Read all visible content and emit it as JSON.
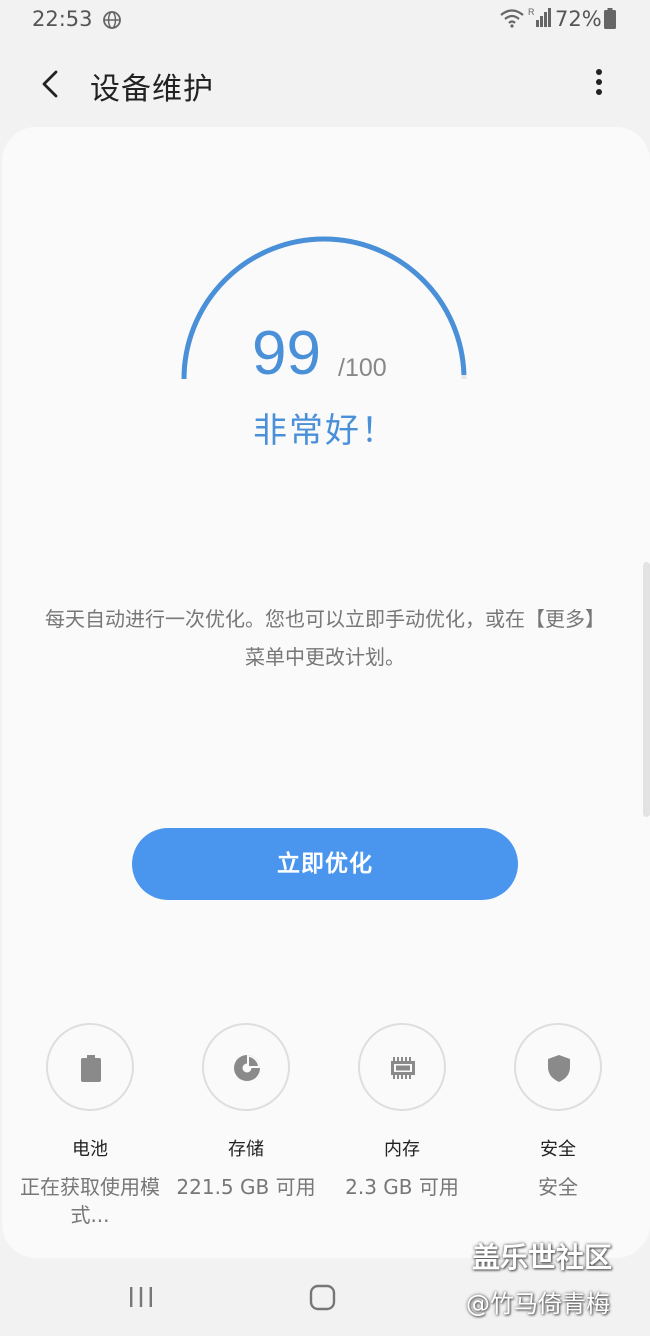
{
  "status_bar": {
    "time": "22:53",
    "battery_percent": "72%"
  },
  "header": {
    "title": "设备维护"
  },
  "score": {
    "value": "99",
    "max": "/100",
    "status": "非常好！",
    "progress_fraction": 0.99
  },
  "description": "每天自动进行一次优化。您也可以立即手动优化，或在【更多】菜单中更改计划。",
  "optimize_button_label": "立即优化",
  "items": [
    {
      "label": "电池",
      "value": "正在获取使用模式...",
      "icon": "battery-icon"
    },
    {
      "label": "存储",
      "value": "221.5 GB 可用",
      "icon": "storage-pie-icon"
    },
    {
      "label": "内存",
      "value": "2.3 GB 可用",
      "icon": "memory-chip-icon"
    },
    {
      "label": "安全",
      "value": "安全",
      "icon": "shield-icon"
    }
  ],
  "watermark": {
    "line1": "盖乐世社区",
    "line2": "@竹马倚青梅"
  },
  "colors": {
    "accent": "#4a90d9",
    "button": "#4a96ee"
  }
}
